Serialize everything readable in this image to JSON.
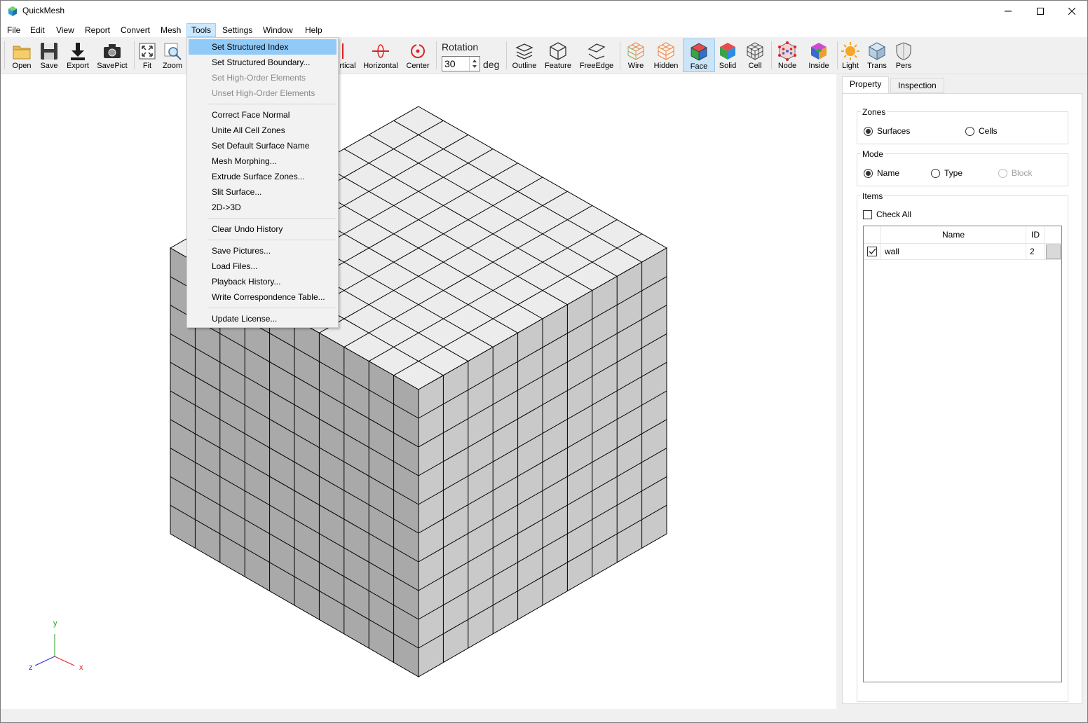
{
  "window": {
    "title": "QuickMesh"
  },
  "menubar": [
    "File",
    "Edit",
    "View",
    "Report",
    "Convert",
    "Mesh",
    "Tools",
    "Settings",
    "Window",
    "Help"
  ],
  "toolbar": {
    "buttons": {
      "open": "Open",
      "save": "Save",
      "export": "Export",
      "savepict": "SavePict",
      "fit": "Fit",
      "zoom": "Zoom",
      "vertical": "rtical",
      "horizontal": "Horizontal",
      "center": "Center",
      "outline": "Outline",
      "feature": "Feature",
      "freeedge": "FreeEdge",
      "wire": "Wire",
      "hidden": "Hidden",
      "face": "Face",
      "solid": "Solid",
      "cell": "Cell",
      "node": "Node",
      "inside": "Inside",
      "light": "Light",
      "trans": "Trans",
      "pers": "Pers"
    },
    "rotation_label": "Rotation",
    "rotation_value": "30",
    "rotation_unit": "deg",
    "pressed": "face"
  },
  "tools_menu": {
    "items": [
      {
        "label": "Set Structured Index",
        "state": "highlighted"
      },
      {
        "label": "Set Structured Boundary...",
        "state": "enabled"
      },
      {
        "label": "Set High-Order Elements",
        "state": "disabled"
      },
      {
        "label": "Unset High-Order Elements",
        "state": "disabled"
      },
      {
        "label": "Correct Face Normal",
        "state": "enabled"
      },
      {
        "label": "Unite All Cell Zones",
        "state": "enabled"
      },
      {
        "label": "Set Default Surface Name",
        "state": "enabled"
      },
      {
        "label": "Mesh Morphing...",
        "state": "enabled"
      },
      {
        "label": "Extrude Surface Zones...",
        "state": "enabled"
      },
      {
        "label": "Slit Surface...",
        "state": "enabled"
      },
      {
        "label": "2D->3D",
        "state": "enabled"
      },
      {
        "label": "Clear Undo History",
        "state": "enabled"
      },
      {
        "label": "Save Pictures...",
        "state": "enabled"
      },
      {
        "label": "Load Files...",
        "state": "enabled"
      },
      {
        "label": "Playback History...",
        "state": "enabled"
      },
      {
        "label": "Write Correspondence Table...",
        "state": "enabled"
      },
      {
        "label": "Update License...",
        "state": "enabled"
      }
    ]
  },
  "viewport": {
    "axes": {
      "y": "y",
      "x": "x",
      "z": "z"
    },
    "mesh_grid": {
      "divisions": 10
    },
    "colors": {
      "top_face": "#ececec",
      "left_face": "#a9a9a9",
      "right_face": "#c9c9c9",
      "edges": "#000000"
    }
  },
  "panel": {
    "tabs": [
      "Property",
      "Inspection"
    ],
    "active_tab": "Property",
    "zones": {
      "title": "Zones",
      "options": [
        "Surfaces",
        "Cells"
      ],
      "selected": "Surfaces"
    },
    "mode": {
      "title": "Mode",
      "options": [
        "Name",
        "Type",
        "Block"
      ],
      "selected": "Name",
      "disabled": [
        "Block"
      ]
    },
    "items": {
      "title": "Items",
      "check_all": "Check All",
      "columns": {
        "name": "Name",
        "id": "ID"
      },
      "rows": [
        {
          "checked": true,
          "name": "wall",
          "id": "2"
        }
      ]
    }
  },
  "colors": {
    "accent": "#91c9f7",
    "pressed": "#cce4f7"
  }
}
